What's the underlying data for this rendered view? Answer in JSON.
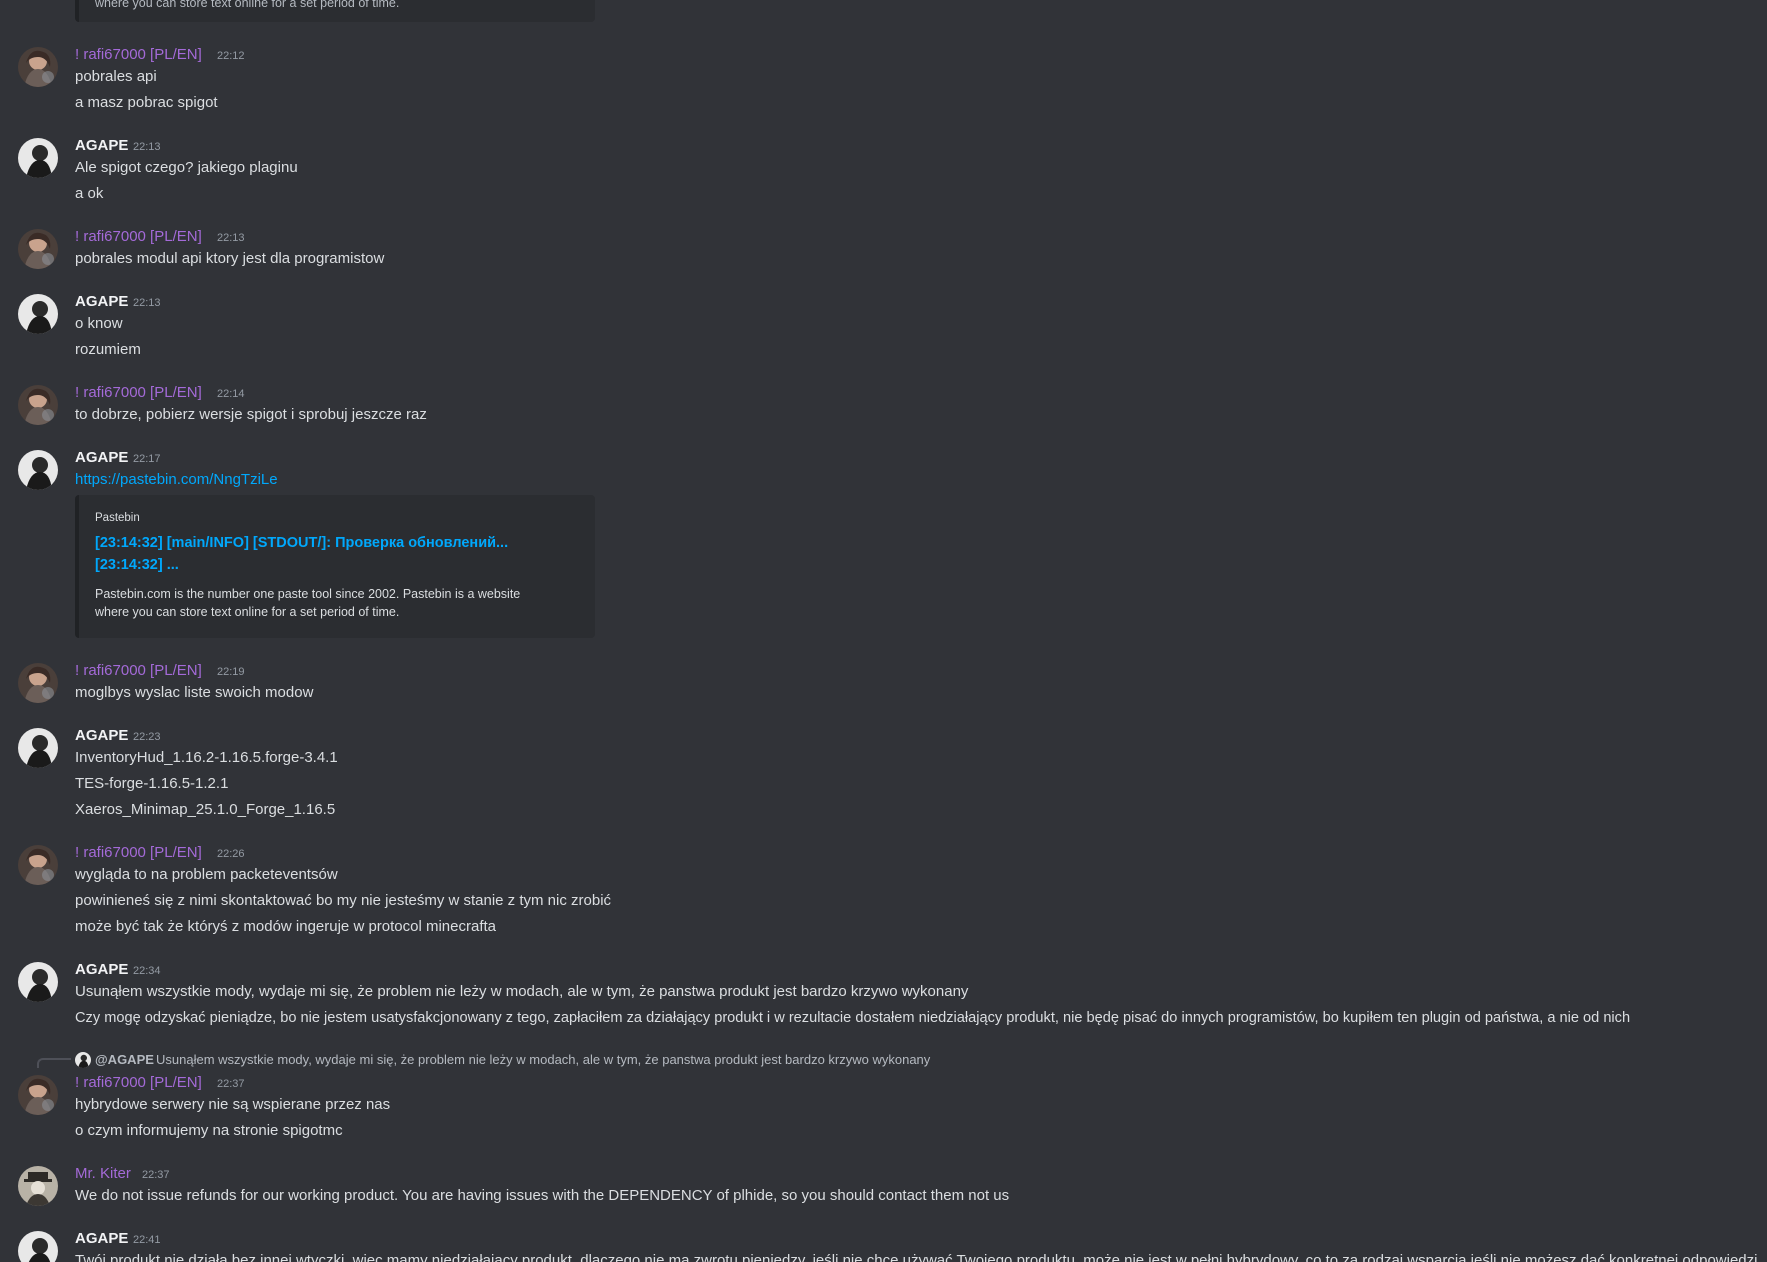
{
  "top_embed_tail": "where you can store text online for a set period of time.",
  "messages": [
    {
      "author": "! rafi67000 [PL/EN]",
      "time": "22:12",
      "lines": [
        "pobrales api",
        "a masz pobrac spigot"
      ]
    },
    {
      "author": "AGAPE",
      "time": "22:13",
      "lines": [
        "Ale spigot czego? jakiego plaginu",
        "a ok"
      ]
    },
    {
      "author": "! rafi67000 [PL/EN]",
      "time": "22:13",
      "lines": [
        "pobrales modul api ktory jest dla programistow"
      ]
    },
    {
      "author": "AGAPE",
      "time": "22:13",
      "lines": [
        "o know",
        "rozumiem"
      ]
    },
    {
      "author": "! rafi67000 [PL/EN]",
      "time": "22:14",
      "lines": [
        "to dobrze, pobierz wersje spigot i sprobuj jeszcze raz"
      ]
    },
    {
      "author": "AGAPE",
      "time": "22:17",
      "link": "https://pastebin.com/NngTziLe",
      "embed": {
        "provider": "Pastebin",
        "title_line1": "[23:14:32] [main/INFO] [STDOUT/]: Проверка обновлений...",
        "title_line2": "[23:14:32] ...",
        "desc_line1": "Pastebin.com is the number one paste tool since 2002. Pastebin is a website",
        "desc_line2": "where you can store text online for a set period of time."
      }
    },
    {
      "author": "! rafi67000 [PL/EN]",
      "time": "22:19",
      "lines": [
        "moglbys wyslac liste swoich modow"
      ]
    },
    {
      "author": "AGAPE",
      "time": "22:23",
      "lines": [
        "InventoryHud_1.16.2-1.16.5.forge-3.4.1",
        "TES-forge-1.16.5-1.2.1",
        "Xaeros_Minimap_25.1.0_Forge_1.16.5"
      ]
    },
    {
      "author": "! rafi67000 [PL/EN]",
      "time": "22:26",
      "lines": [
        "wygląda to na problem packeteventsów",
        "powinieneś się z nimi skontaktować bo my nie jesteśmy w stanie z tym nic zrobić",
        "może być tak że któryś z modów ingeruje w protocol minecrafta"
      ]
    },
    {
      "author": "AGAPE",
      "time": "22:34",
      "lines": [
        "Usunąłem wszystkie mody, wydaje mi się, że problem nie leży w modach, ale w tym, że panstwa produkt jest bardzo krzywo wykonany",
        "Czy mogę odzyskać pieniądze, bo nie jestem usatysfakcjonowany z tego, zapłaciłem za działający produkt i w rezultacie dostałem niedziałający produkt, nie będę pisać do innych programistów, bo kupiłem ten plugin od państwa, a nie od nich"
      ]
    },
    {
      "author": "! rafi67000 [PL/EN]",
      "time": "22:37",
      "reply": {
        "name": "@AGAPE",
        "text": "Usunąłem wszystkie mody, wydaje mi się, że problem nie leży w modach, ale w tym, że panstwa produkt jest bardzo krzywo wykonany"
      },
      "lines": [
        "hybrydowe serwery nie są wspierane przez nas",
        "o czym informujemy na stronie spigotmc"
      ]
    },
    {
      "author": "Mr. Kiter",
      "time": "22:37",
      "lines": [
        "We do not issue refunds for our working product. You are having issues with the DEPENDENCY of plhide, so you should contact them not us"
      ]
    },
    {
      "author": "AGAPE",
      "time": "22:41",
      "lines": [
        "Twój produkt nie działa bez innej wtyczki, więc mamy niedziałający produkt, dlaczego nie ma zwrotu pieniędzy, jeśli nie chcę używać Twojego produktu, może nie jest w pełni hybrydowy, co to za rodzaj wsparcia jeśli nie możesz dać konkretnej odpowiedzi"
      ]
    }
  ],
  "colors": {
    "background": "#313338",
    "embed_bg": "#2b2d31",
    "role_purple": "#a46ad8",
    "link_blue": "#00a8fc"
  },
  "icons": {
    "avatar_rafi": "user-avatar-anime-icon",
    "avatar_agape": "user-avatar-dark-icon",
    "avatar_kiter": "user-avatar-hat-icon",
    "reply_spine": "reply-connector-icon"
  }
}
